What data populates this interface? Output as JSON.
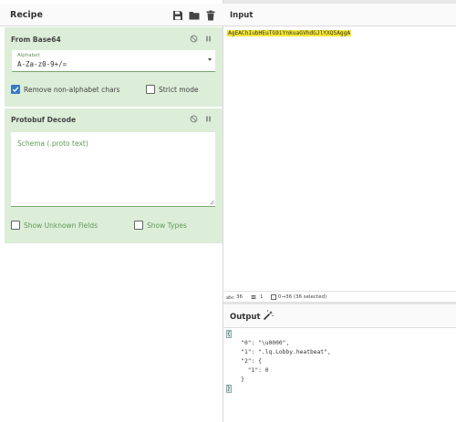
{
  "recipe": {
    "title": "Recipe",
    "icons": [
      "save-icon",
      "folder-icon",
      "trash-icon"
    ],
    "operations": [
      {
        "name": "From Base64",
        "alphabet_label": "Alphabet",
        "alphabet_value": "A-Za-z0-9+/=",
        "remove_label": "Remove non-alphabet chars",
        "remove_checked": true,
        "strict_label": "Strict mode",
        "strict_checked": false
      },
      {
        "name": "Protobuf Decode",
        "schema_placeholder": "Schema (.proto text)",
        "unknown_label": "Show Unknown Fields",
        "unknown_checked": false,
        "types_label": "Show Types",
        "types_checked": false
      }
    ]
  },
  "input": {
    "title": "Input",
    "text": "AgEAChIubHEuTG9iYnkuaGVhdGJlYXQSAggA",
    "status": {
      "length": "36",
      "lines": "1",
      "selection": "0→36 (36 selected)"
    }
  },
  "output": {
    "title": "Output",
    "lines": [
      "{",
      "    \"0\": \"\\u0000\",",
      "    \"1\": \".lq.Lobby.heatbeat\",",
      "    \"2\": {",
      "      \"1\": 0",
      "    }",
      "}"
    ]
  },
  "colors": {
    "operation_bg": "#dcedd8",
    "checkbox_on": "#3a7bbf",
    "input_highlight": "#f3e733"
  }
}
